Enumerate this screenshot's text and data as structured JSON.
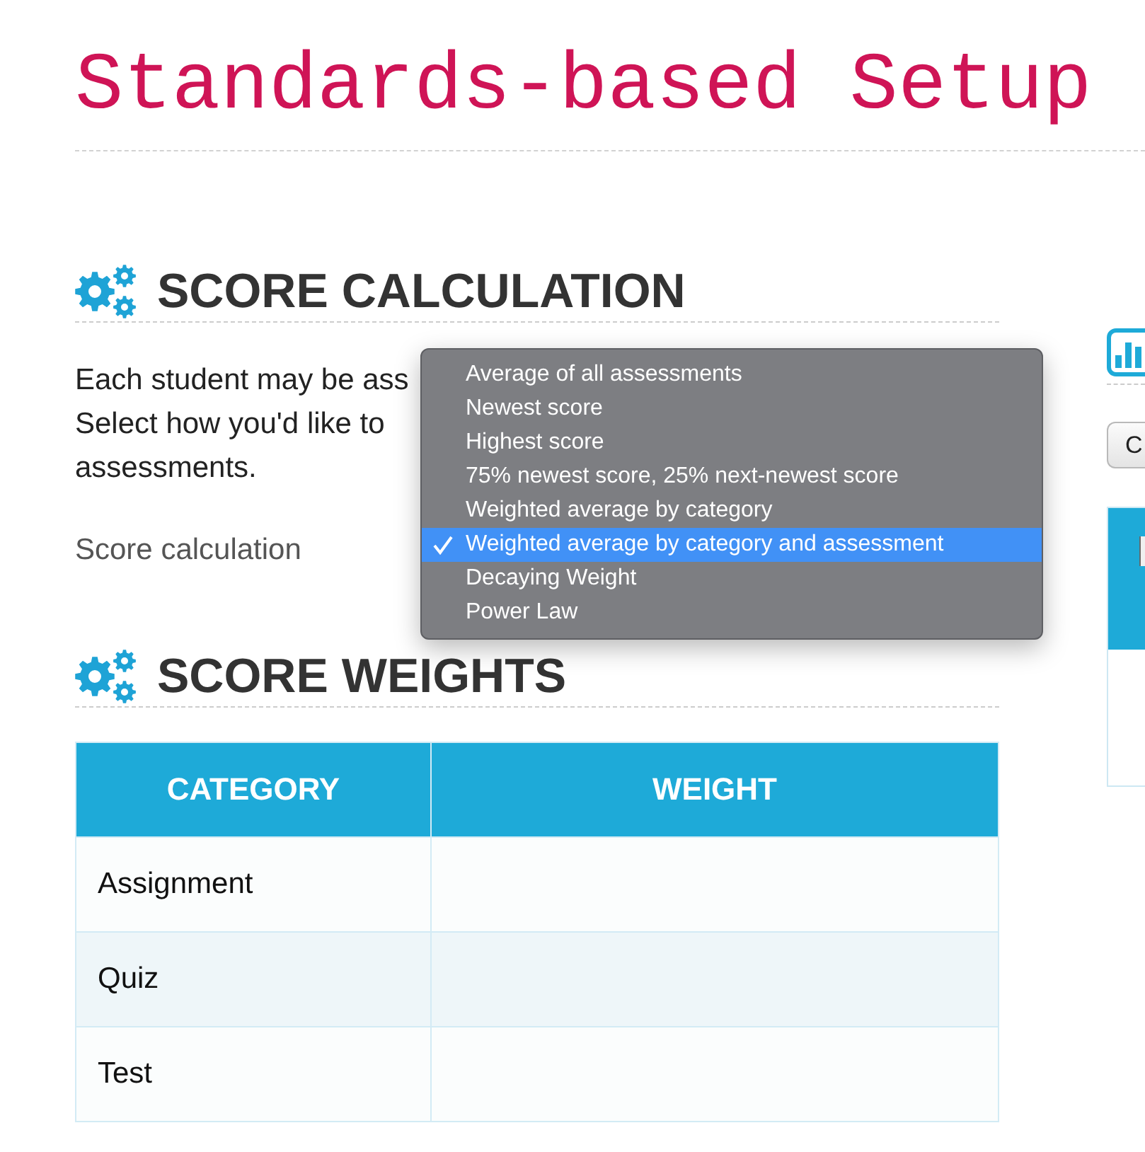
{
  "page_title": "Standards-based Setup",
  "score_calculation": {
    "heading": "SCORE CALCULATION",
    "description_lines": [
      "Each student may be ass",
      "Select how you'd like to",
      "assessments."
    ],
    "field_label": "Score calculation",
    "menu": {
      "options": [
        {
          "label": "Average of all assessments",
          "selected": false
        },
        {
          "label": "Newest score",
          "selected": false
        },
        {
          "label": "Highest score",
          "selected": false
        },
        {
          "label": "75% newest score, 25% next-newest score",
          "selected": false
        },
        {
          "label": "Weighted average by category",
          "selected": false
        },
        {
          "label": "Weighted average by category and assessment",
          "selected": true
        },
        {
          "label": "Decaying Weight",
          "selected": false
        },
        {
          "label": "Power Law",
          "selected": false
        }
      ]
    }
  },
  "score_weights": {
    "heading": "SCORE WEIGHTS",
    "table": {
      "columns": [
        "CATEGORY",
        "WEIGHT"
      ],
      "rows": [
        {
          "category": "Assignment"
        },
        {
          "category": "Quiz"
        },
        {
          "category": "Test"
        }
      ]
    }
  },
  "side_panel": {
    "button": {
      "label": "C"
    }
  }
}
